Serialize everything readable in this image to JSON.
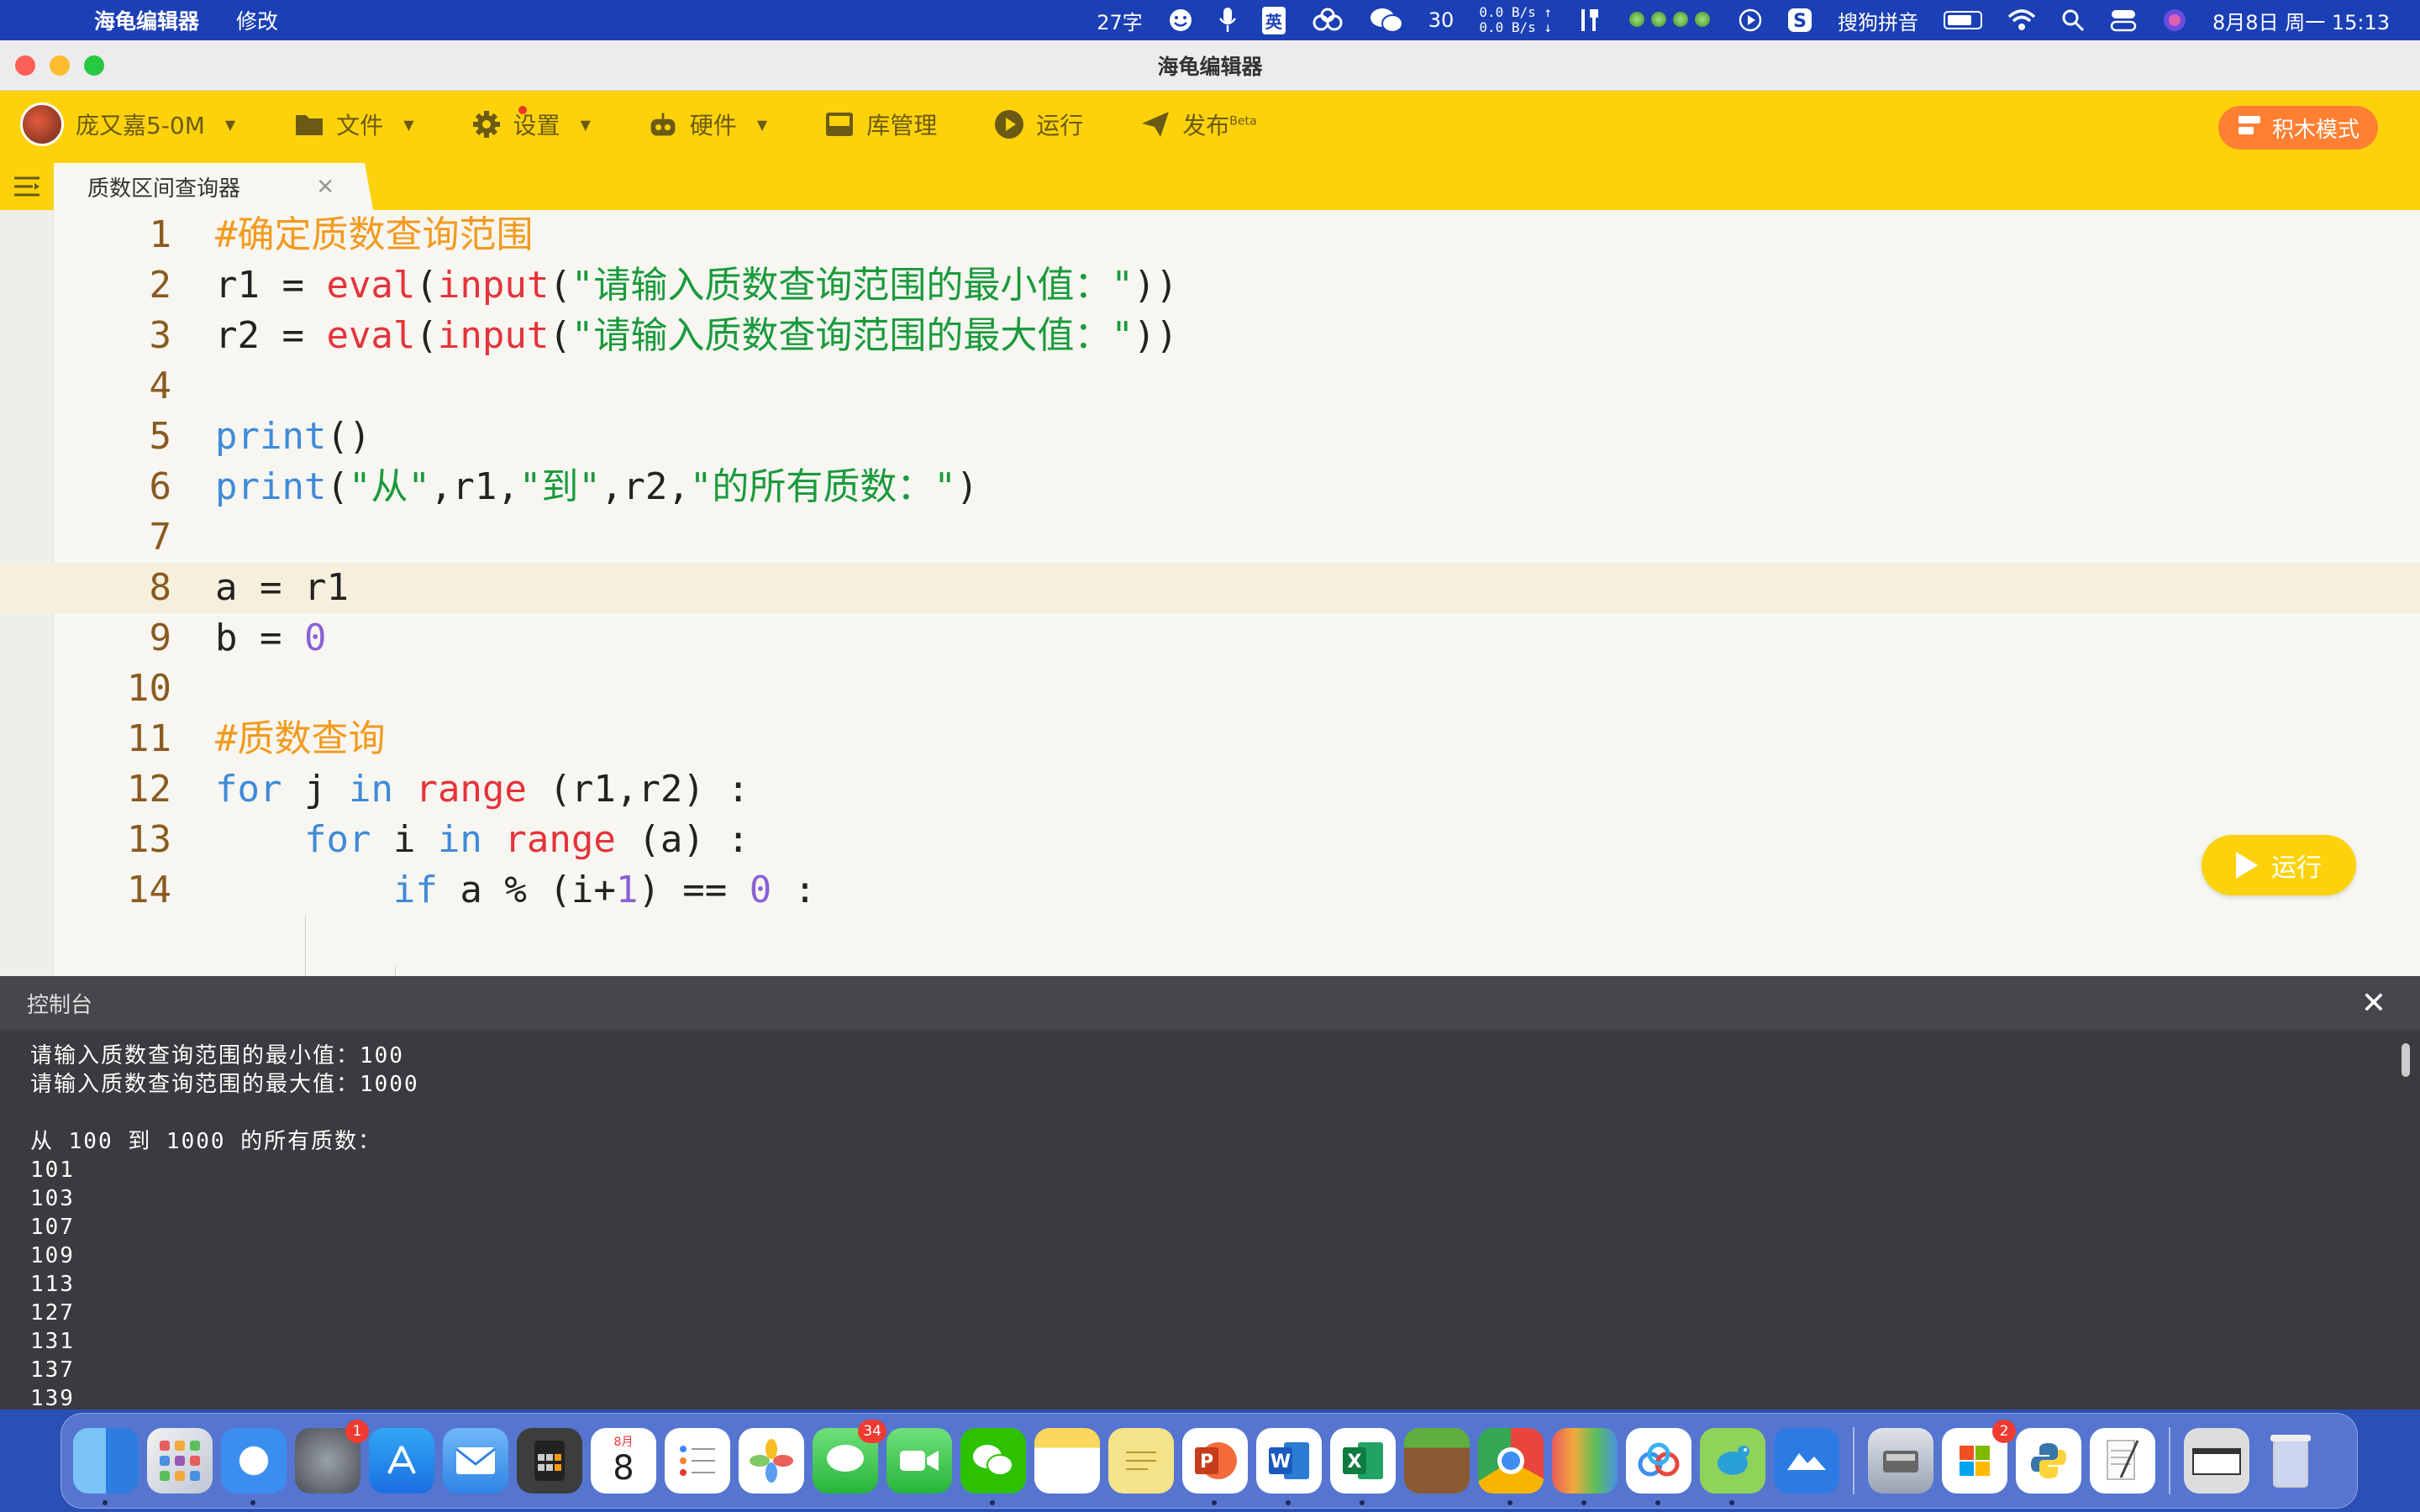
{
  "menubar": {
    "app_name": "海龟编辑器",
    "menu_edit": "修改",
    "word_count": "27字",
    "ime_lang": "英",
    "wechat_count": "30",
    "net_up": "0.0 B/s ↑",
    "net_down": "0.0 B/s ↓",
    "ime_name": "搜狗拼音",
    "datetime": "8月8日 周一  15:13"
  },
  "window": {
    "title": "海龟编辑器"
  },
  "toolbar": {
    "user_name": "庞又嘉5-0M",
    "file": "文件",
    "settings": "设置",
    "hardware": "硬件",
    "library": "库管理",
    "run": "运行",
    "publish": "发布",
    "publish_badge": "Beta",
    "block_mode": "积木模式"
  },
  "tab": {
    "name": "质数区间查询器"
  },
  "editor": {
    "lines": [
      {
        "n": "1",
        "code": "#确定质数查询范围"
      },
      {
        "n": "2",
        "code": "r1 = eval(input(\"请输入质数查询范围的最小值：\"))"
      },
      {
        "n": "3",
        "code": "r2 = eval(input(\"请输入质数查询范围的最大值：\"))"
      },
      {
        "n": "4",
        "code": ""
      },
      {
        "n": "5",
        "code": "print()"
      },
      {
        "n": "6",
        "code": "print(\"从\",r1,\"到\",r2,\"的所有质数：\")"
      },
      {
        "n": "7",
        "code": ""
      },
      {
        "n": "8",
        "code": "a = r1"
      },
      {
        "n": "9",
        "code": "b = 0"
      },
      {
        "n": "10",
        "code": ""
      },
      {
        "n": "11",
        "code": "#质数查询"
      },
      {
        "n": "12",
        "code": "for j in range (r1,r2) :"
      },
      {
        "n": "13",
        "code": "    for i in range (a) :"
      },
      {
        "n": "14",
        "code": "        if a % (i+1) == 0 :"
      }
    ],
    "run_button": "运行"
  },
  "console": {
    "title": "控制台",
    "output": "请输入质数查询范围的最小值：100\n请输入质数查询范围的最大值：1000\n\n从 100 到 1000 的所有质数：\n101\n103\n107\n109\n113\n127\n131\n137\n139"
  },
  "dock": {
    "calendar_month": "8月",
    "calendar_day": "8",
    "badges": {
      "settings": "1",
      "messages": "34",
      "store": "2"
    }
  }
}
